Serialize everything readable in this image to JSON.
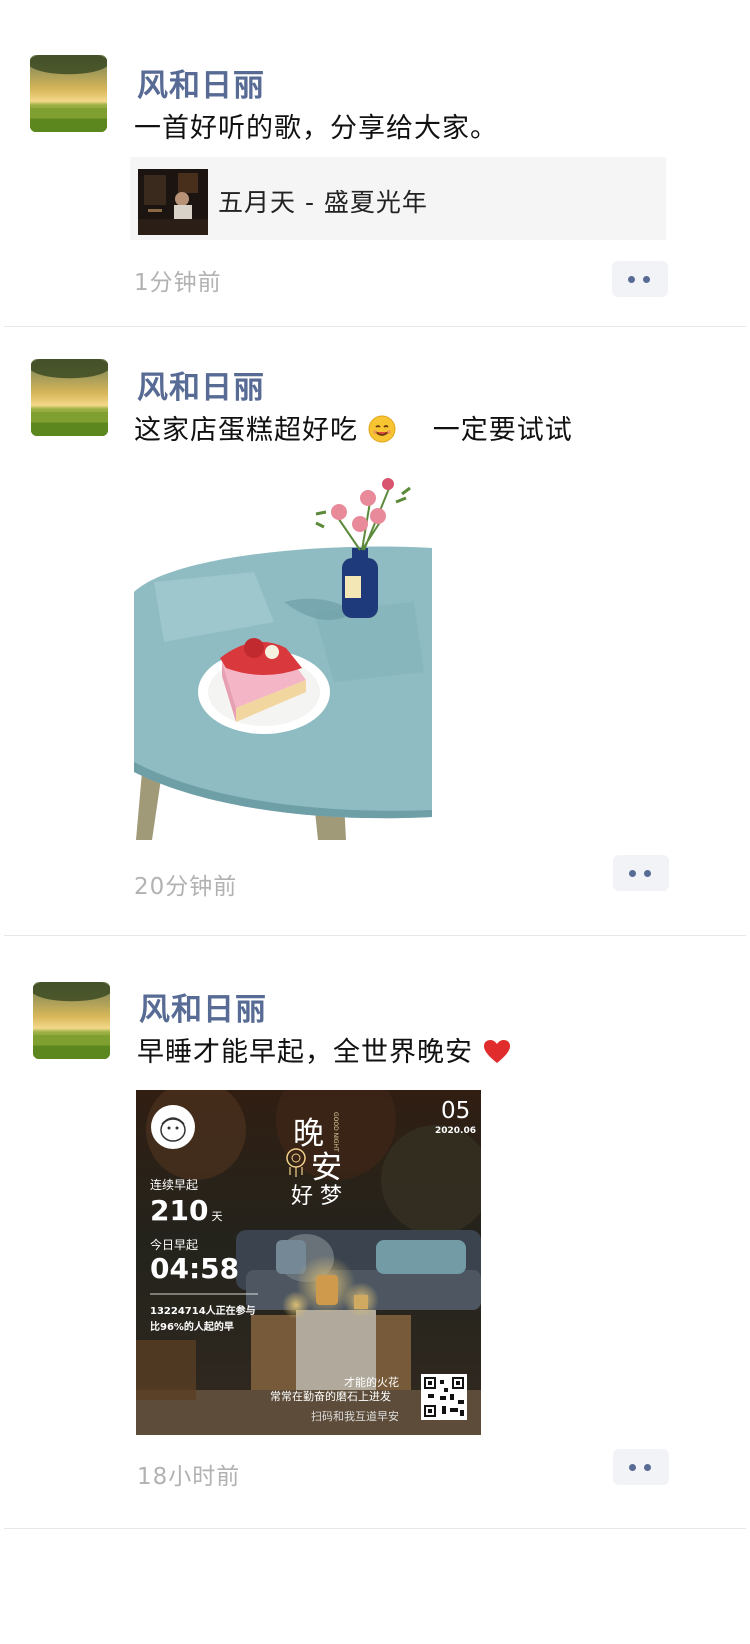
{
  "posts": [
    {
      "name": "风和日丽",
      "text": "一首好听的歌，分享给大家。",
      "music": {
        "title": "五月天 - 盛夏光年"
      },
      "time": "1分钟前"
    },
    {
      "name": "风和日丽",
      "text_before": "这家店蛋糕超好吃",
      "text_after": "一定要试试",
      "emoji": "smiling-face-icon",
      "time": "20分钟前"
    },
    {
      "name": "风和日丽",
      "text": "早睡才能早起，全世界晚安",
      "emoji": "red-heart-icon",
      "card": {
        "day": "05",
        "month": "2020.06",
        "title1": "晚",
        "title2": "安",
        "title3": "好 梦",
        "good_night": "GOOD NIGHT",
        "streak_label": "连续早起",
        "streak_value": "210",
        "streak_unit": "天",
        "today_label": "今日早起",
        "today_value": "04:58",
        "stat1": "13224714人正在参与",
        "stat2": "比96%的人起的早",
        "quote1": "才能的火花",
        "quote2": "常常在勤奋的磨石上进发",
        "scan": "扫码和我互道早安"
      },
      "time": "18小时前"
    }
  ],
  "colors": {
    "name": "#576b95",
    "time": "#b2b2b2",
    "divider": "#e8e8e8",
    "music_bg": "#f5f5f5"
  }
}
